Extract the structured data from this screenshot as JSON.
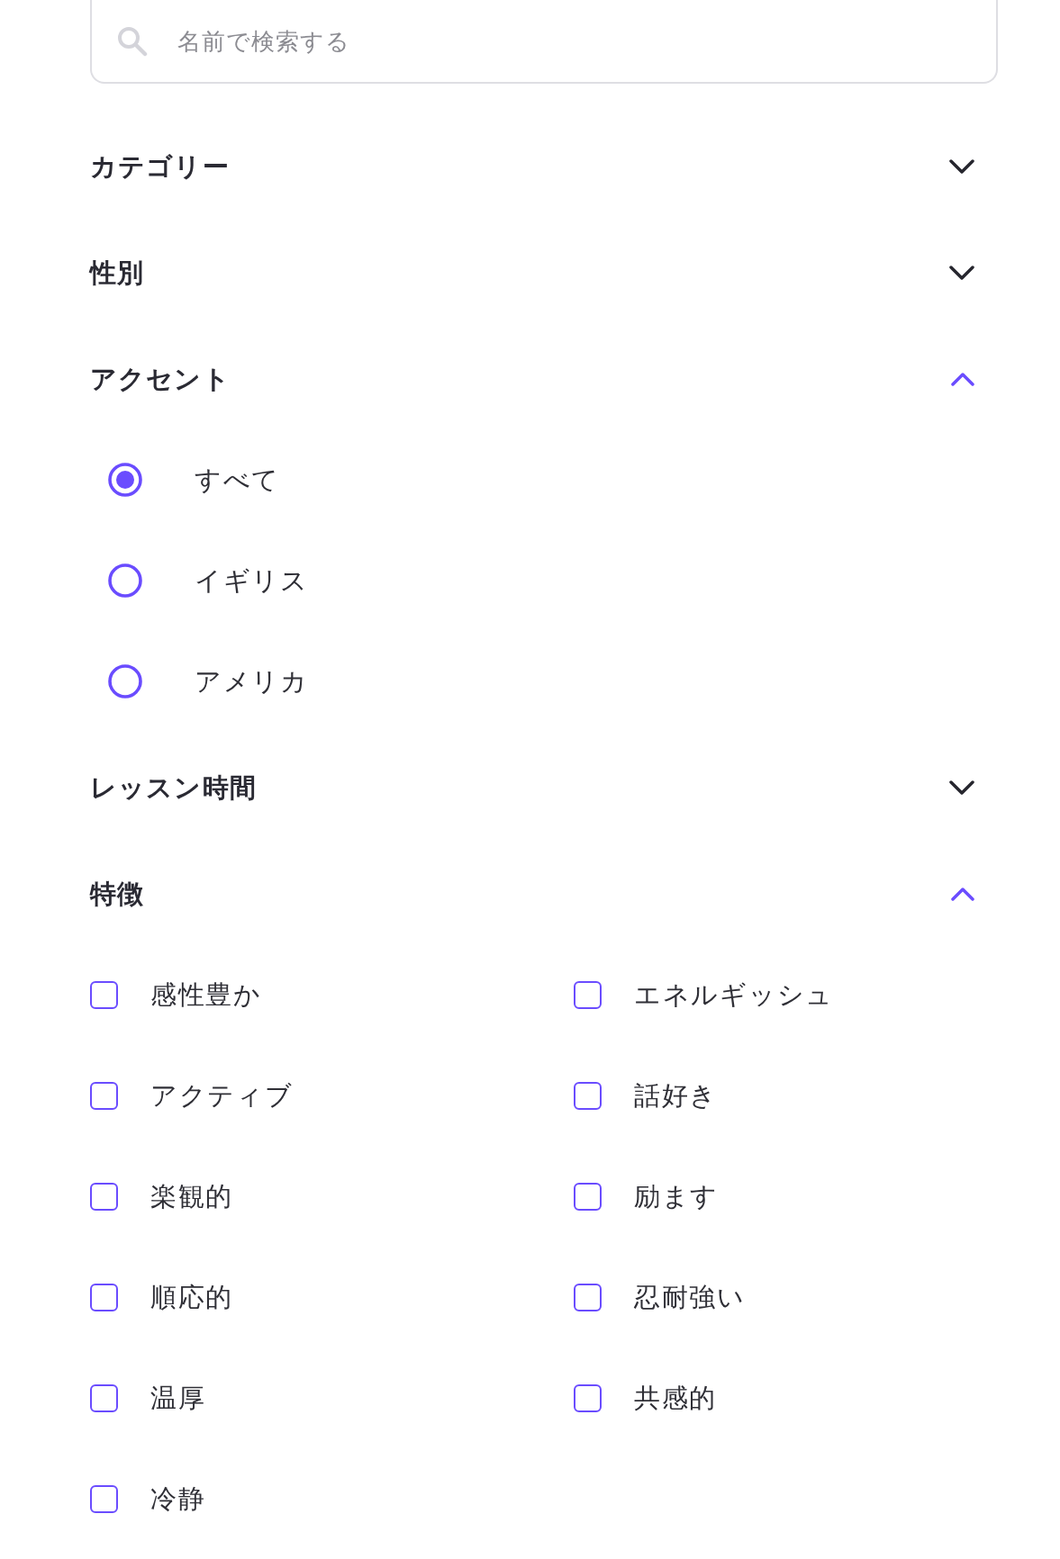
{
  "search": {
    "placeholder": "名前で検索する"
  },
  "sections": [
    {
      "title": "カテゴリー",
      "expanded": false
    },
    {
      "title": "性別",
      "expanded": false
    },
    {
      "title": "アクセント",
      "expanded": true,
      "kind": "radio",
      "options": [
        {
          "label": "すべて",
          "selected": true
        },
        {
          "label": "イギリス",
          "selected": false
        },
        {
          "label": "アメリカ",
          "selected": false
        }
      ]
    },
    {
      "title": "レッスン時間",
      "expanded": false
    },
    {
      "title": "特徴",
      "expanded": true,
      "kind": "checkbox",
      "options": [
        {
          "label": "感性豊か",
          "checked": false
        },
        {
          "label": "エネルギッシュ",
          "checked": false
        },
        {
          "label": "アクティブ",
          "checked": false
        },
        {
          "label": "話好き",
          "checked": false
        },
        {
          "label": "楽観的",
          "checked": false
        },
        {
          "label": "励ます",
          "checked": false
        },
        {
          "label": "順応的",
          "checked": false
        },
        {
          "label": "忍耐強い",
          "checked": false
        },
        {
          "label": "温厚",
          "checked": false
        },
        {
          "label": "共感的",
          "checked": false
        },
        {
          "label": "冷静",
          "checked": false
        }
      ]
    }
  ]
}
